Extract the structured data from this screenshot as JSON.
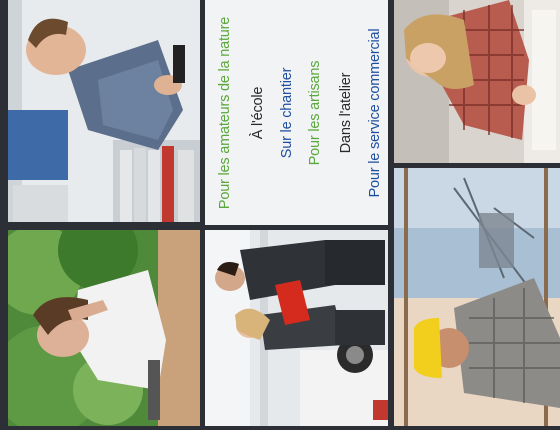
{
  "text_panel": {
    "lines": [
      {
        "text": "Pour les amateurs de la nature",
        "color": "#5aa83b"
      },
      {
        "text": "À l'école",
        "color": "#2a2a2a"
      },
      {
        "text": "Sur le chantier",
        "color": "#1f4fa0"
      },
      {
        "text": "Pour les artisans",
        "color": "#5aa83b"
      },
      {
        "text": "Dans l'atelier",
        "color": "#2a2a2a"
      },
      {
        "text": "Pour le service commercial",
        "color": "#1f4fa0"
      }
    ]
  },
  "photos": [
    {
      "name": "office-man-on-phone"
    },
    {
      "name": "woman-thinking-outdoors"
    },
    {
      "name": "two-people-talking-at-car"
    },
    {
      "name": "woman-student-writing"
    },
    {
      "name": "worker-with-hard-hat-construction"
    }
  ],
  "colors": {
    "background": "#2c2f36",
    "panel_bg": "#f1f3f4",
    "green": "#5aa83b",
    "blue": "#1f4fa0"
  }
}
